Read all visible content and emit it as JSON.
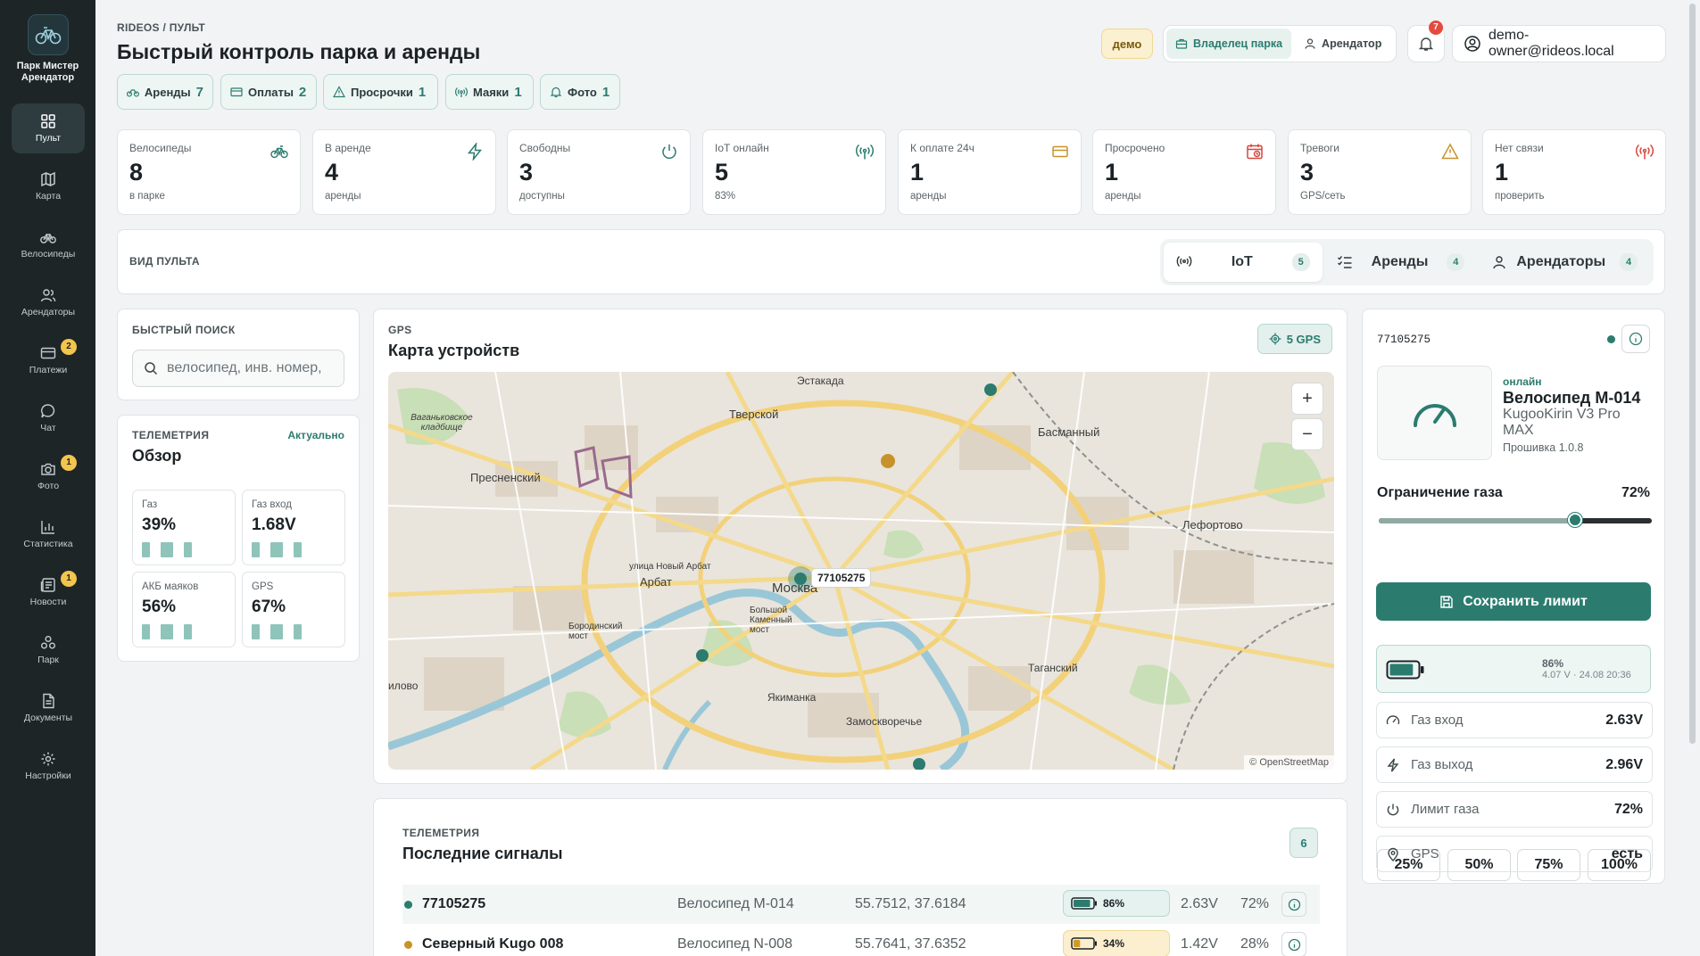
{
  "sidebar": {
    "brand": "Парк Мистер Арендатор",
    "items": [
      {
        "label": "Пульт",
        "icon": "dashboard-icon"
      },
      {
        "label": "Карта",
        "icon": "map-icon"
      },
      {
        "label": "Велосипеды",
        "icon": "bike-icon"
      },
      {
        "label": "Арендаторы",
        "icon": "users-icon"
      },
      {
        "label": "Платежи",
        "icon": "card-icon",
        "badge": "2"
      },
      {
        "label": "Чат",
        "icon": "chat-icon"
      },
      {
        "label": "Фото",
        "icon": "camera-icon",
        "badge": "1"
      },
      {
        "label": "Статистика",
        "icon": "chart-icon"
      },
      {
        "label": "Новости",
        "icon": "news-icon",
        "badge": "1"
      },
      {
        "label": "Парк",
        "icon": "park-icon"
      },
      {
        "label": "Документы",
        "icon": "document-icon"
      },
      {
        "label": "Настройки",
        "icon": "settings-icon"
      }
    ]
  },
  "header": {
    "breadcrumb": "RIDEOS / ПУЛЬТ",
    "title": "Быстрый контроль парка и аренды",
    "demo": "демо",
    "roles": [
      {
        "label": "Владелец парка"
      },
      {
        "label": "Арендатор"
      }
    ],
    "notifications": "7",
    "user": "demo-owner@rideos.local"
  },
  "pills": [
    {
      "label": "Аренды",
      "count": "7"
    },
    {
      "label": "Оплаты",
      "count": "2"
    },
    {
      "label": "Просрочки",
      "count": "1"
    },
    {
      "label": "Маяки",
      "count": "1"
    },
    {
      "label": "Фото",
      "count": "1"
    }
  ],
  "stats": [
    {
      "label": "Велосипеды",
      "value": "8",
      "sub": "в парке"
    },
    {
      "label": "В аренде",
      "value": "4",
      "sub": "аренды"
    },
    {
      "label": "Свободны",
      "value": "3",
      "sub": "доступны"
    },
    {
      "label": "IoT онлайн",
      "value": "5",
      "sub": "83%"
    },
    {
      "label": "К оплате 24ч",
      "value": "1",
      "sub": "аренды"
    },
    {
      "label": "Просрочено",
      "value": "1",
      "sub": "аренды"
    },
    {
      "label": "Тревоги",
      "value": "3",
      "sub": "GPS/сеть"
    },
    {
      "label": "Нет связи",
      "value": "1",
      "sub": "проверить"
    }
  ],
  "mode": {
    "label": "ВИД ПУЛЬТА",
    "tabs": [
      {
        "label": "IoT",
        "count": "5"
      },
      {
        "label": "Аренды",
        "count": "4"
      },
      {
        "label": "Арендаторы",
        "count": "4"
      }
    ]
  },
  "search": {
    "title": "БЫСТРЫЙ ПОИСК",
    "placeholder": "велосипед, инв. номер,"
  },
  "telemetry": {
    "eyebrow": "ТЕЛЕМЕТРИЯ",
    "title": "Обзор",
    "status": "Актуально",
    "tiles": [
      {
        "label": "Газ",
        "value": "39%"
      },
      {
        "label": "Газ вход",
        "value": "1.68V"
      },
      {
        "label": "АКБ маяков",
        "value": "56%"
      },
      {
        "label": "GPS",
        "value": "67%"
      }
    ]
  },
  "map": {
    "eyebrow": "GPS",
    "title": "Карта устройств",
    "gps_count": "5 GPS",
    "marker_label": "77105275",
    "attribution": "© OpenStreetMap",
    "places": [
      "Эстакада",
      "Тверской",
      "Басманный",
      "Пресненский",
      "Ваганьковское кладбище",
      "Лефортово",
      "улица Новый Арбат",
      "Арбат",
      "Москва",
      "Большой Каменный мост",
      "Бородинский мост",
      "Якиманка",
      "Таганский",
      "Замоскворечье",
      "илово"
    ]
  },
  "signals": {
    "eyebrow": "ТЕЛЕМЕТРИЯ",
    "title": "Последние сигналы",
    "count": "6",
    "rows": [
      {
        "name": "77105275",
        "bike": "Велосипед М-014",
        "coords": "55.7512, 37.6184",
        "battery": "86%",
        "battery_level": 0.86,
        "voltage": "2.63V",
        "limit": "72%",
        "status_color": "#2b7c6f",
        "battery_bg": "#e6f2ef",
        "battery_fill": "#2b7c6f"
      },
      {
        "name": "Северный Kugo 008",
        "bike": "Велосипед N-008",
        "coords": "55.7641, 37.6352",
        "battery": "34%",
        "battery_level": 0.34,
        "voltage": "1.42V",
        "limit": "28%",
        "status_color": "#c8922a",
        "battery_bg": "#fbefcf",
        "battery_fill": "#d19a21"
      }
    ]
  },
  "device": {
    "id": "77105275",
    "status": "онлайн",
    "name": "Велосипед М-014",
    "model": "KugooKirin V3 Pro MAX",
    "firmware": "Прошивка 1.0.8",
    "limit_label": "Ограничение газа",
    "limit_value": "72%",
    "limit_level": 0.72,
    "presets": [
      "25%",
      "50%",
      "75%",
      "100%"
    ],
    "save_label": "Сохранить лимит",
    "battery_pct": "86%",
    "battery_detail": "4.07 V · 24.08 20:36",
    "rows": [
      {
        "label": "Газ вход",
        "value": "2.63V",
        "icon": "gauge-icon"
      },
      {
        "label": "Газ выход",
        "value": "2.96V",
        "icon": "bolt-icon"
      },
      {
        "label": "Лимит газа",
        "value": "72%",
        "icon": "power-icon"
      },
      {
        "label": "GPS",
        "value": "есть",
        "icon": "pin-icon"
      }
    ]
  },
  "colors": {
    "accent": "#2b7c6f",
    "sidebar": "#1e2527",
    "warning": "#f3c54c",
    "danger": "#e44b3f"
  }
}
